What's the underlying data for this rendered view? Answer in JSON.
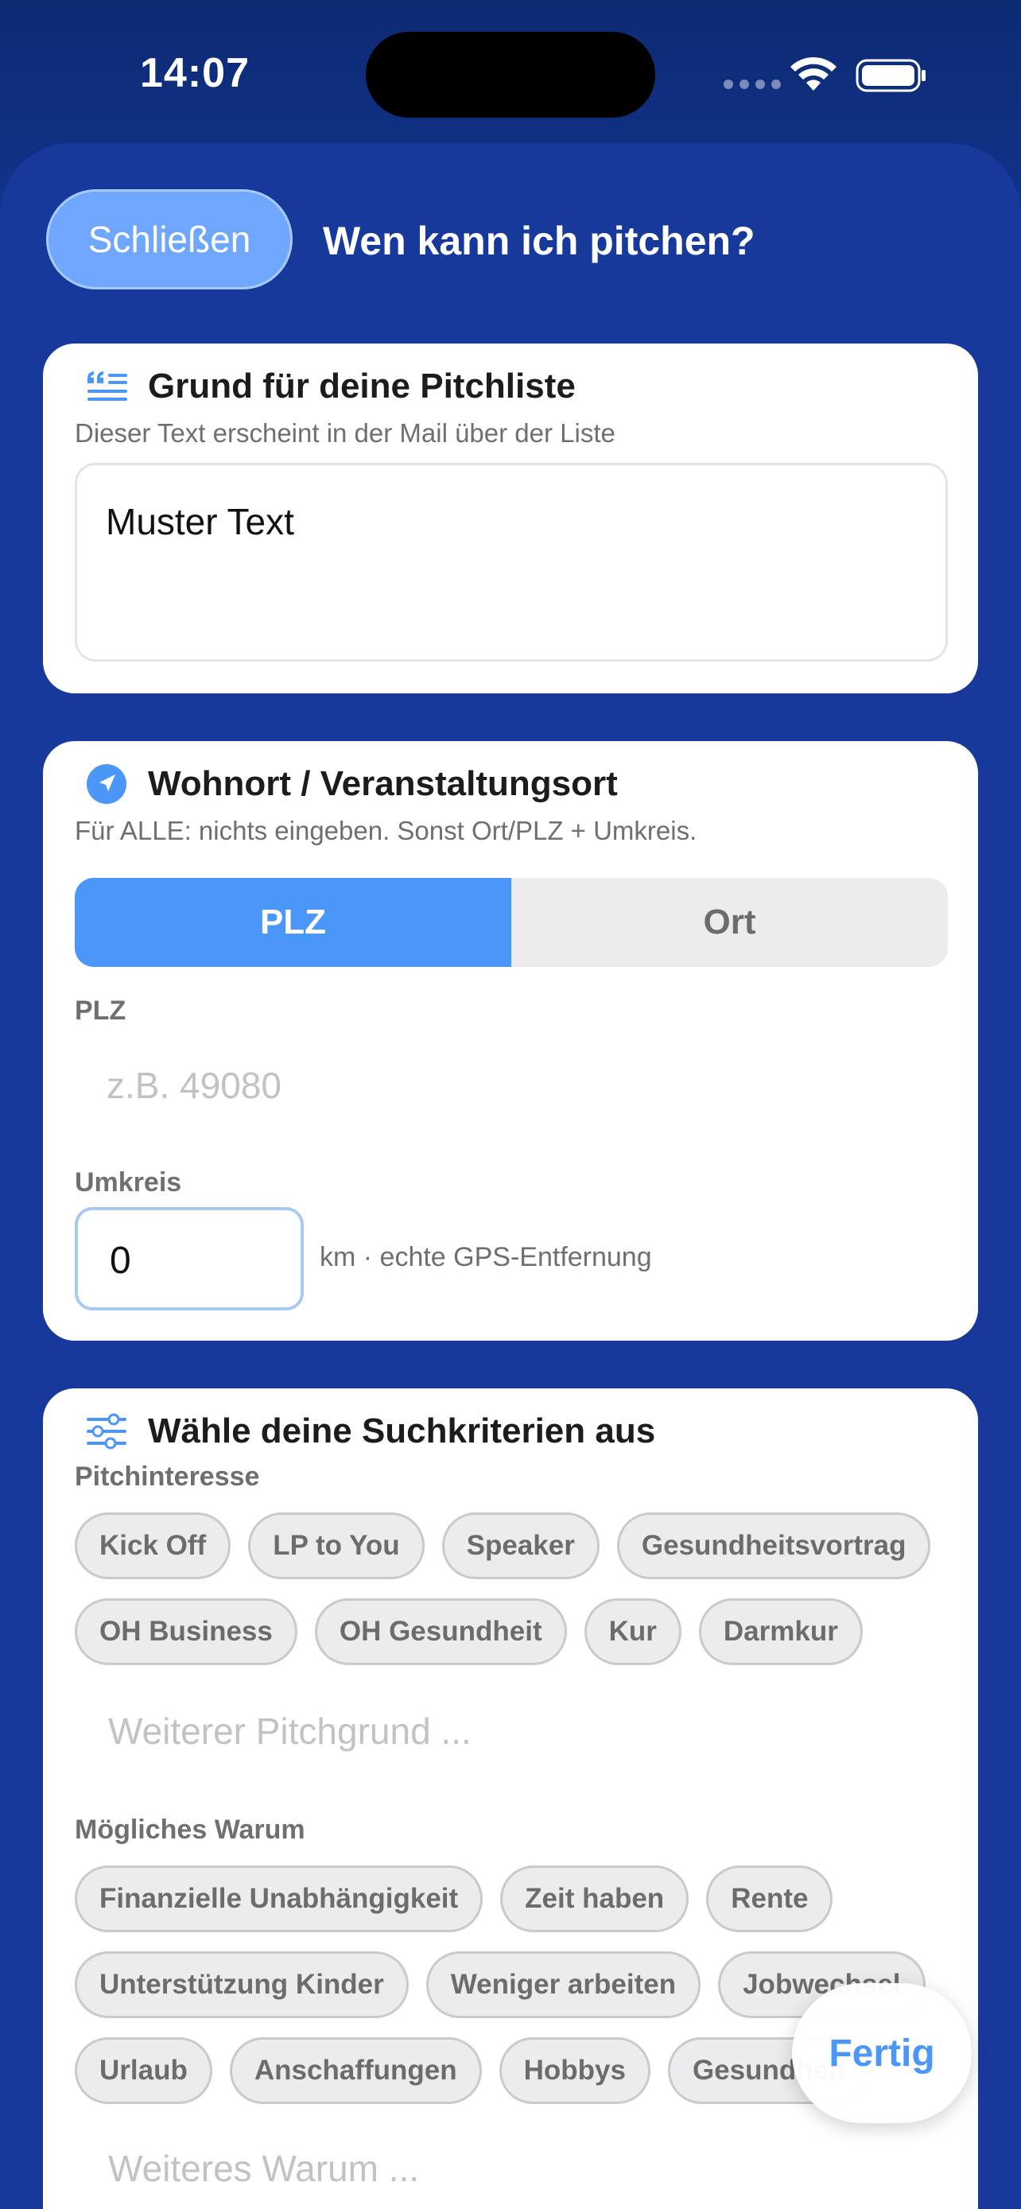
{
  "status_bar": {
    "time": "14:07"
  },
  "header": {
    "close_label": "Schließen",
    "title": "Wen kann ich pitchen?"
  },
  "reason_card": {
    "title": "Grund für deine Pitchliste",
    "subtitle": "Dieser Text erscheint in der Mail über der Liste",
    "text_value": "Muster Text",
    "icon": "quote-list-icon"
  },
  "location_card": {
    "title": "Wohnort / Veranstaltungsort",
    "subtitle": "Für ALLE: nichts eingeben. Sonst Ort/PLZ + Umkreis.",
    "icon": "location-arrow-icon",
    "segments": [
      "PLZ",
      "Ort"
    ],
    "selected_segment": "PLZ",
    "plz_label": "PLZ",
    "plz_placeholder": "z.B. 49080",
    "radius_label": "Umkreis",
    "radius_value": "0",
    "radius_hint": "km · echte GPS-Entfernung"
  },
  "criteria_card": {
    "title": "Wähle deine Suchkriterien aus",
    "icon": "sliders-icon",
    "pitch_interest_label": "Pitchinteresse",
    "pitch_interest_chips": [
      "Kick Off",
      "LP to You",
      "Speaker",
      "Gesundheitsvortrag",
      "OH Business",
      "OH Gesundheit",
      "Kur",
      "Darmkur"
    ],
    "pitch_reason_placeholder": "Weiterer Pitchgrund ...",
    "why_label": "Mögliches Warum",
    "why_chips": [
      "Finanzielle Unabhängigkeit",
      "Zeit haben",
      "Rente",
      "Unterstützung Kinder",
      "Weniger arbeiten",
      "Jobwechsel",
      "Urlaub",
      "Anschaffungen",
      "Hobbys",
      "Gesundheit"
    ],
    "why_placeholder": "Weiteres Warum ..."
  },
  "done_label": "Fertig",
  "colors": {
    "accent": "#4a97f9",
    "background": "#17399c",
    "close_button": "#6fa7ff"
  }
}
